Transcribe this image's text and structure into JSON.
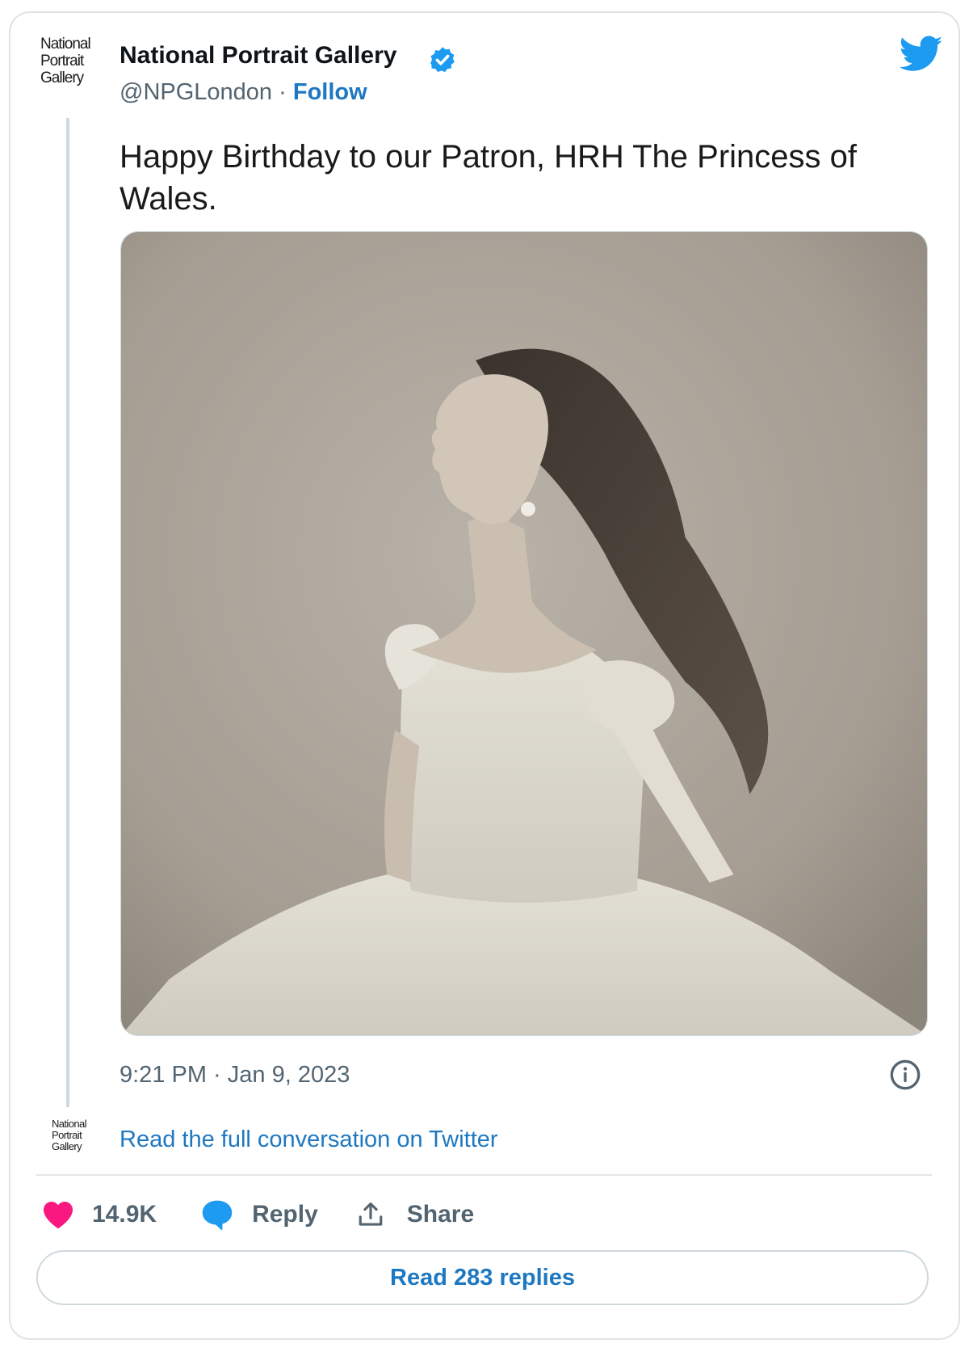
{
  "author": {
    "logo_lines": [
      "National",
      "Portrait",
      "Gallery"
    ],
    "name": "National Portrait Gallery",
    "verified": true,
    "handle": "@NPGLondon",
    "separator": "·",
    "follow_label": "Follow"
  },
  "tweet": {
    "text": "Happy Birthday to our Patron, HRH The Princess of Wales.",
    "timestamp": "9:21 PM · Jan 9, 2023"
  },
  "conversation": {
    "logo_lines": [
      "National",
      "Portrait",
      "Gallery"
    ],
    "link_label": "Read the full conversation on Twitter"
  },
  "actions": {
    "like_count": "14.9K",
    "reply_label": "Reply",
    "share_label": "Share"
  },
  "footer": {
    "read_replies_label": "Read 283 replies"
  },
  "colors": {
    "accent_blue": "#1d78c1",
    "twitter_blue": "#1d9bf0",
    "like_pink": "#f91880",
    "muted_text": "#536471"
  },
  "icons": [
    "verified-badge-icon",
    "twitter-bird-icon",
    "info-icon",
    "heart-icon",
    "reply-bubble-icon",
    "share-icon"
  ]
}
